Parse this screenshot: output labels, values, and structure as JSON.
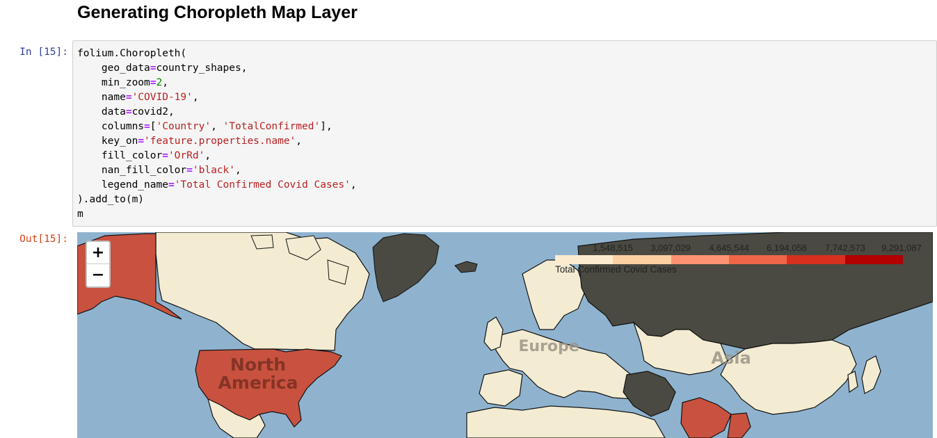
{
  "heading": "Generating Choropleth Map Layer",
  "cells": {
    "input_prompt": "In [15]:",
    "output_prompt": "Out[15]:",
    "code_lines": [
      "folium.Choropleth(",
      "    geo_data=country_shapes,",
      "    min_zoom=2,",
      "    name='COVID-19',",
      "    data=covid2,",
      "    columns=['Country', 'TotalConfirmed'],",
      "    key_on='feature.properties.name',",
      "    fill_color='OrRd',",
      "    nan_fill_color='black',",
      "    legend_name='Total Confirmed Covid Cases',",
      ").add_to(m)",
      "m"
    ]
  },
  "map": {
    "zoom_in_label": "+",
    "zoom_out_label": "−",
    "legend": {
      "ticks": [
        "1,548,515",
        "3,097,029",
        "4,645,544",
        "6,194,058",
        "7,742,573",
        "9,291,087"
      ],
      "colors": [
        "#fdebd0",
        "#fdd0a2",
        "#fc9272",
        "#ef6548",
        "#d7301f",
        "#b30000"
      ],
      "caption": "Total Confirmed Covid Cases"
    },
    "continent_labels": {
      "north_america_1": "North",
      "north_america_2": "America",
      "europe": "Europe",
      "asia": "Asia"
    },
    "colors": {
      "ocean": "#8fb3cf",
      "land": "#f3ecd2",
      "high_cases": "#c8523f",
      "no_data": "#4a4a42"
    }
  }
}
